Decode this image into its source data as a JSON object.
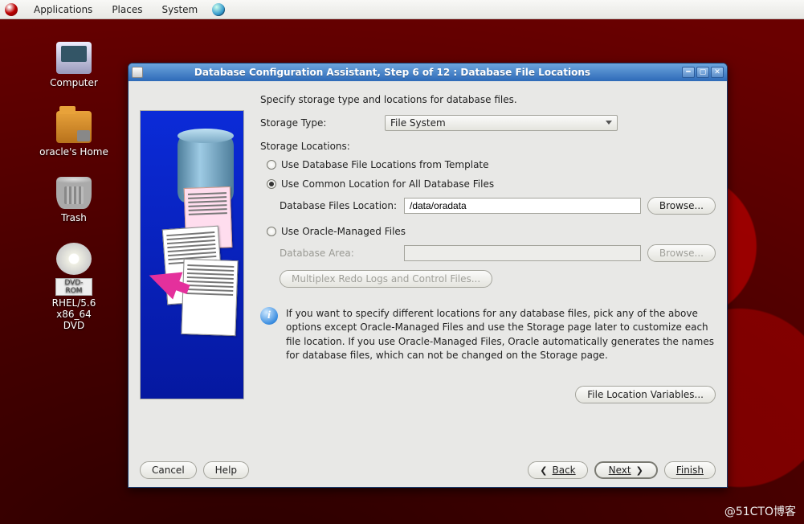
{
  "panel": {
    "menus": [
      "Applications",
      "Places",
      "System"
    ]
  },
  "desktop": {
    "icons": [
      {
        "name": "computer",
        "label": "Computer"
      },
      {
        "name": "home",
        "label": "oracle's Home"
      },
      {
        "name": "trash",
        "label": "Trash"
      },
      {
        "name": "dvd",
        "badge": "DVD-ROM",
        "label": "RHEL/5.6 x86_64\nDVD"
      }
    ]
  },
  "window": {
    "title": "Database Configuration Assistant, Step 6 of 12 : Database File Locations"
  },
  "form": {
    "intro": "Specify storage type and locations for database files.",
    "storage_type_label": "Storage Type:",
    "storage_type_value": "File System",
    "storage_locations_label": "Storage Locations:",
    "opt_template": "Use Database File Locations from Template",
    "opt_common": "Use Common Location for All Database Files",
    "db_files_loc_label": "Database Files Location:",
    "db_files_loc_value": "/data/oradata",
    "browse": "Browse...",
    "opt_omf": "Use Oracle-Managed Files",
    "db_area_label": "Database Area:",
    "db_area_value": "",
    "browse_disabled": "Browse...",
    "multiplex": "Multiplex Redo Logs and Control Files...",
    "info_text": "If you want to specify different locations for any database files, pick any of the above options except Oracle-Managed Files and use the Storage page later to customize each file location. If you use Oracle-Managed Files, Oracle automatically generates the names for database files, which can not be changed on the Storage page.",
    "file_loc_vars": "File Location Variables..."
  },
  "footer": {
    "cancel": "Cancel",
    "help": "Help",
    "back": "Back",
    "next": "Next",
    "finish": "Finish"
  },
  "watermark": "@51CTO博客"
}
